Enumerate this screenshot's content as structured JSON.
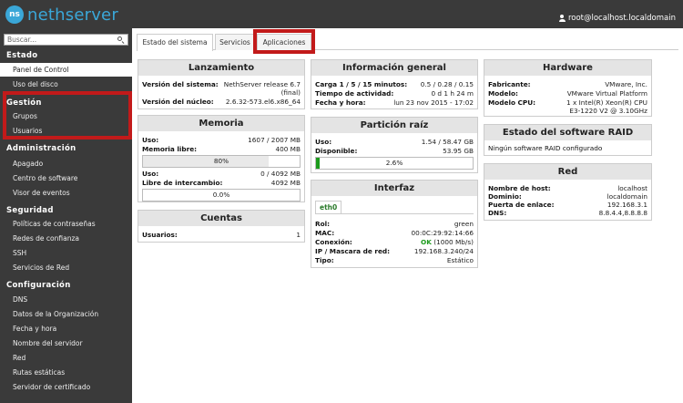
{
  "header": {
    "brand": "nethserver",
    "brand_mark": "ns",
    "user": "root@localhost.localdomain"
  },
  "sidebar": {
    "search_placeholder": "Buscar...",
    "sections": [
      {
        "title": "Estado",
        "items": [
          "Panel de Control",
          "Uso del disco"
        ]
      },
      {
        "title": "Gestión",
        "items": [
          "Grupos",
          "Usuarios"
        ]
      },
      {
        "title": "Administración",
        "items": [
          "Apagado",
          "Centro de software",
          "Visor de eventos"
        ]
      },
      {
        "title": "Seguridad",
        "items": [
          "Políticas de contraseñas",
          "Redes de confianza",
          "SSH",
          "Servicios de Red"
        ]
      },
      {
        "title": "Configuración",
        "items": [
          "DNS",
          "Datos de la Organización",
          "Fecha y hora",
          "Nombre del servidor",
          "Red",
          "Rutas estáticas",
          "Servidor de certificado"
        ]
      }
    ]
  },
  "tabs": [
    "Estado del sistema",
    "Servicios",
    "Aplicaciones"
  ],
  "lanzamiento": {
    "title": "Lanzamiento",
    "version_label": "Versión del sistema:",
    "version_value_1": "NethServer release 6.7",
    "version_value_2": "(final)",
    "kernel_label": "Versión del núcleo:",
    "kernel_value": "2.6.32-573.el6.x86_64"
  },
  "memoria": {
    "title": "Memoria",
    "uso_label": "Uso:",
    "uso_value": "1607 / 2007 MB",
    "libre_label": "Memoria libre:",
    "libre_value": "400 MB",
    "mem_percent": 80,
    "mem_bar_label": "80%",
    "swap_uso_label": "Uso:",
    "swap_uso_value": "0 / 4092 MB",
    "swap_libre_label": "Libre de intercambio:",
    "swap_libre_value": "4092 MB",
    "swap_percent": 0,
    "swap_bar_label": "0.0%"
  },
  "cuentas": {
    "title": "Cuentas",
    "usuarios_label": "Usuarios:",
    "usuarios_value": "1"
  },
  "info": {
    "title": "Información general",
    "carga_label": "Carga 1 / 5 / 15 minutos:",
    "carga_value": "0.5 / 0.28 / 0.15",
    "tiempo_label": "Tiempo de actividad:",
    "tiempo_value": "0 d 1 h 24 m",
    "fecha_label": "Fecha y hora:",
    "fecha_value": "lun 23 nov 2015 - 17:02"
  },
  "particion": {
    "title": "Partición raíz",
    "uso_label": "Uso:",
    "uso_value": "1.54 / 58.47 GB",
    "disp_label": "Disponible:",
    "disp_value": "53.95 GB",
    "disk_percent": 2.6,
    "disk_bar_label": "2.6%"
  },
  "interfaz": {
    "title": "Interfaz",
    "tab": "eth0",
    "rol_label": "Rol:",
    "rol_value": "green",
    "mac_label": "MAC:",
    "mac_value": "00:0C:29:92:14:66",
    "conexion_label": "Conexión:",
    "conexion_ok": "OK",
    "conexion_speed": "(1000 Mb/s)",
    "ip_label": "IP / Mascara de red:",
    "ip_value": "192.168.3.240/24",
    "tipo_label": "Tipo:",
    "tipo_value": "Estático"
  },
  "hardware": {
    "title": "Hardware",
    "fab_label": "Fabricante:",
    "fab_value": "VMware, Inc.",
    "modelo_label": "Modelo:",
    "modelo_value": "VMware Virtual Platform",
    "cpu_label": "Modelo CPU:",
    "cpu_value_1": "1 x Intel(R) Xeon(R) CPU",
    "cpu_value_2": "E3-1220 V2 @ 3.10GHz"
  },
  "raid": {
    "title": "Estado del software RAID",
    "text": "Ningún software RAID configurado"
  },
  "red": {
    "title": "Red",
    "host_label": "Nombre de host:",
    "host_value": "localhost",
    "dom_label": "Dominio:",
    "dom_value": "localdomain",
    "gw_label": "Puerta de enlace:",
    "gw_value": "192.168.3.1",
    "dns_label": "DNS:",
    "dns_value": "8.8.4.4,8.8.8.8"
  },
  "colors": {
    "accent": "#3aa7d8",
    "highlight": "#c21a1a",
    "mem_fill": "#e9e9e9",
    "disk_fill": "#1b9a1b"
  }
}
